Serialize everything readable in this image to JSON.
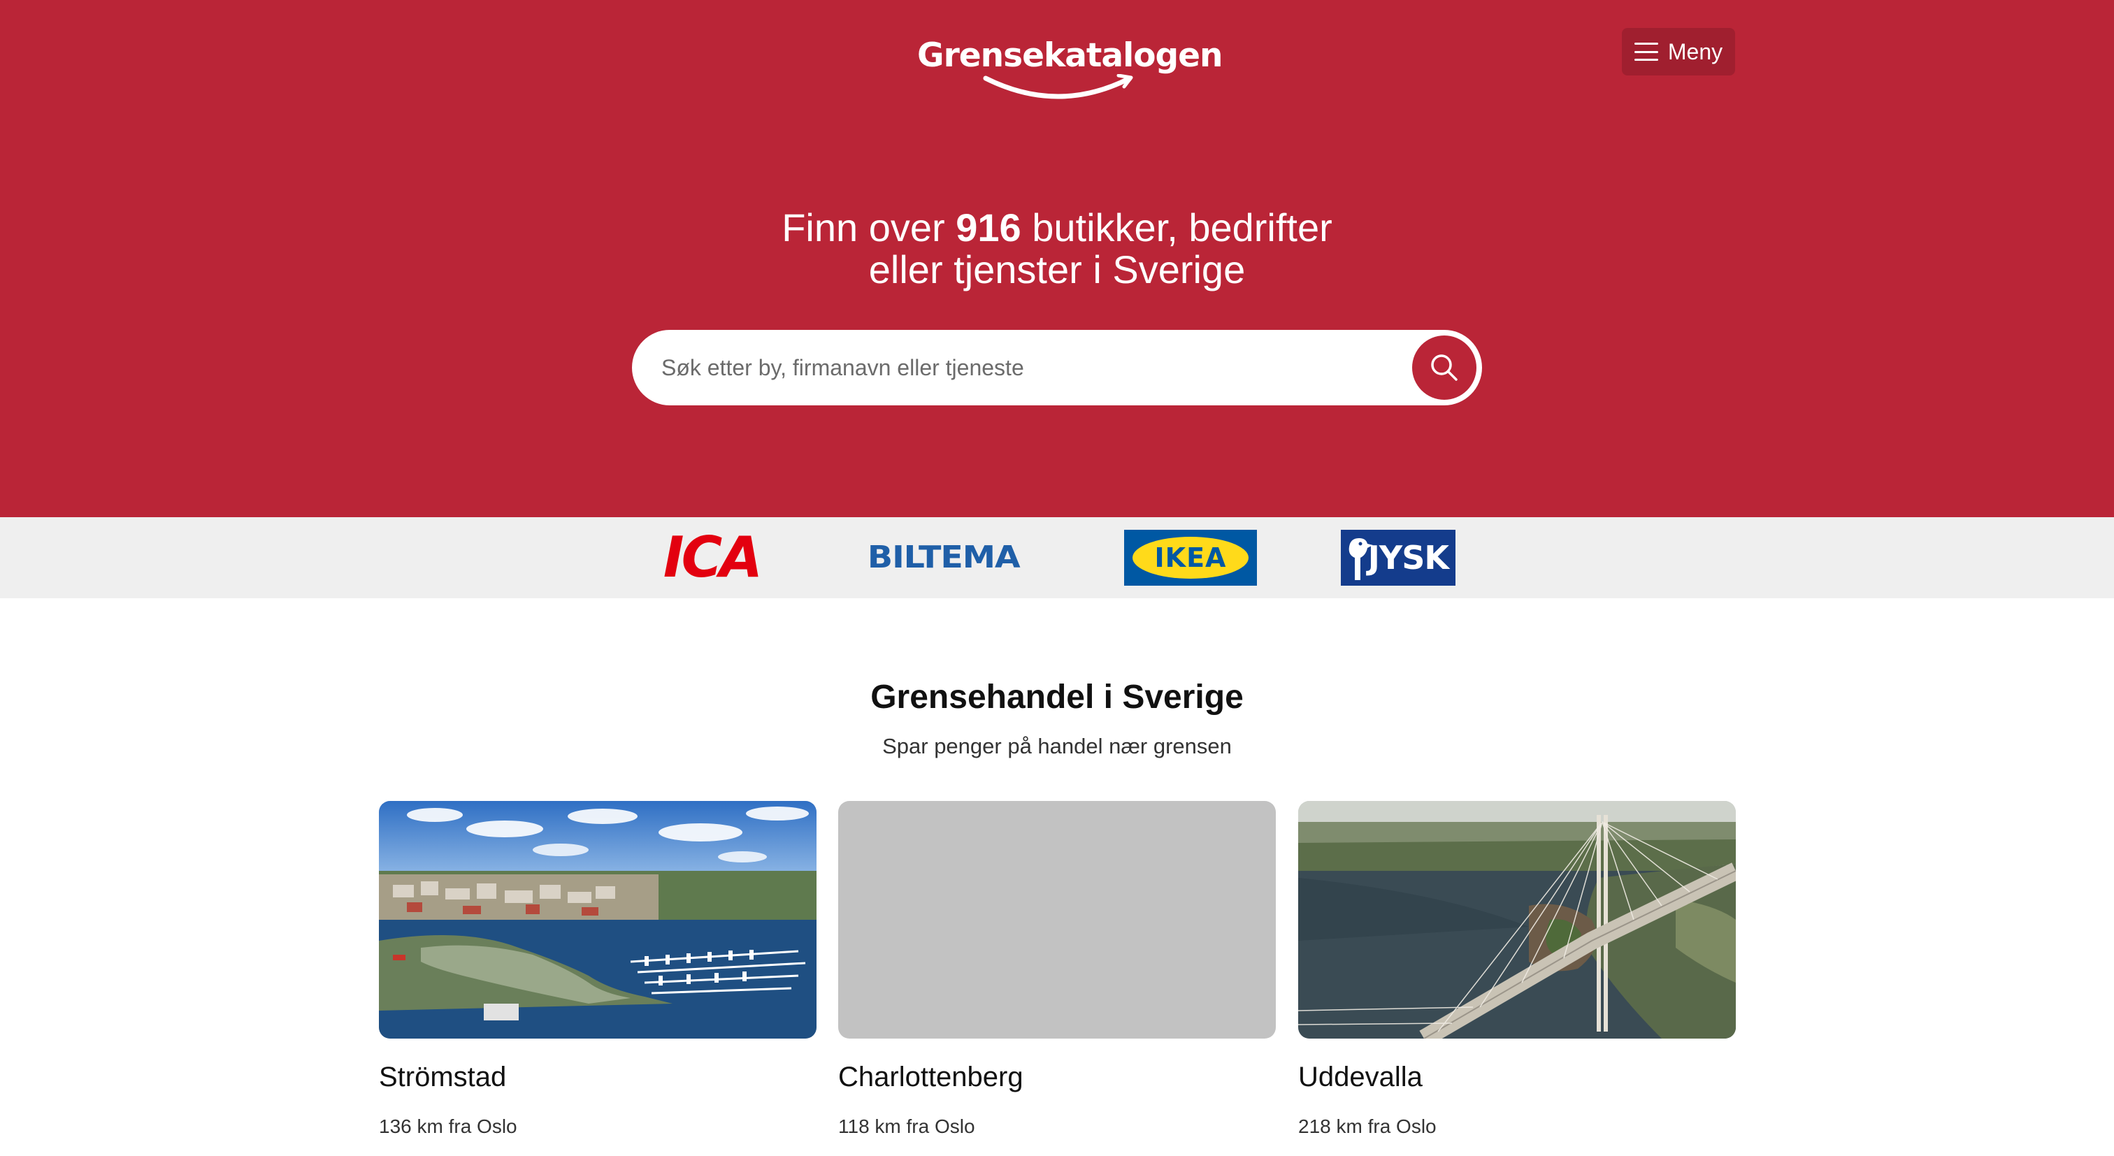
{
  "header": {
    "logo_text": "Grensekatalogen",
    "menu_label": "Meny"
  },
  "hero": {
    "headline_prefix": "Finn over ",
    "headline_count": "916",
    "headline_suffix": " butikker, bedrifter",
    "headline_line2": "eller tjenster i Sverige",
    "search_placeholder": "Søk etter by, firmanavn eller tjeneste",
    "search_value": ""
  },
  "brands": {
    "items": [
      {
        "name": "ICA",
        "color": "#e3000f"
      },
      {
        "name": "BILTEMA",
        "color": "#1f5fa8"
      },
      {
        "name": "IKEA",
        "color": "#0058a3"
      },
      {
        "name": "JYSK",
        "color": "#143c8c"
      }
    ]
  },
  "section": {
    "title": "Grensehandel i Sverige",
    "subtitle": "Spar penger på handel nær grensen"
  },
  "cards": [
    {
      "title": "Strömstad",
      "distance": "136 km fra Oslo",
      "image": "harbor-aerial-photo"
    },
    {
      "title": "Charlottenberg",
      "distance": "118 km fra Oslo",
      "image": "placeholder"
    },
    {
      "title": "Uddevalla",
      "distance": "218 km fra Oslo",
      "image": "bridge-aerial-photo"
    }
  ],
  "colors": {
    "brand_red": "#ba2537",
    "menu_button": "#a01f2f",
    "strip_bg": "#efefef",
    "placeholder_gray": "#c2c2c2"
  }
}
